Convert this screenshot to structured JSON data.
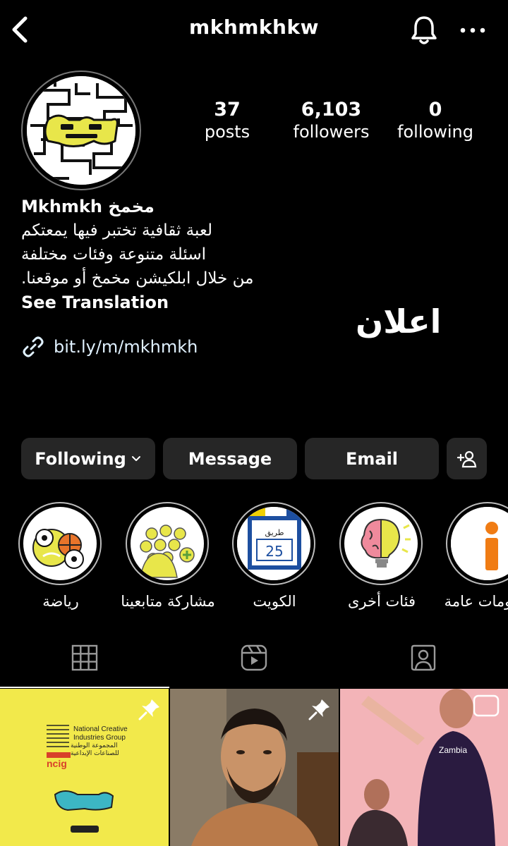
{
  "header": {
    "username": "mkhmkhkw",
    "icons": {
      "back": "back-chevron-icon",
      "bell": "bell-icon",
      "more": "more-dots-icon"
    }
  },
  "stats": {
    "posts": {
      "value": "37",
      "label": "posts"
    },
    "followers": {
      "value": "6,103",
      "label": "followers"
    },
    "following": {
      "value": "0",
      "label": "following"
    }
  },
  "bio": {
    "name": "Mkhmkh مخمخ",
    "lines": [
      "لعبة ثقافية تختبر فيها يمعتكم",
      "اسئلة متنوعة وفئات مختلفة",
      "من خلال ابلكيشن مخمخ أو موقعنا."
    ],
    "see_translation": "See Translation",
    "link": "bit.ly/m/mkhmkh"
  },
  "ad_label": "اعلان",
  "actions": {
    "following": "Following",
    "message": "Message",
    "email": "Email"
  },
  "highlights": [
    {
      "label": "رياضة",
      "icon": "sports-balls-icon"
    },
    {
      "label": "مشاركة متابعينا",
      "icon": "crowd-icon"
    },
    {
      "label": "الكويت",
      "icon": "street-sign-icon"
    },
    {
      "label": "فئات أخرى",
      "icon": "brain-bulb-icon"
    },
    {
      "label": "معلومات عامة",
      "icon": "info-icon"
    }
  ],
  "tabs": [
    {
      "name": "grid-tab",
      "icon": "grid-icon",
      "active": true
    },
    {
      "name": "reels-tab",
      "icon": "reels-icon",
      "active": false
    },
    {
      "name": "tagged-tab",
      "icon": "tagged-person-icon",
      "active": false
    }
  ],
  "posts": [
    {
      "pinned": true,
      "text_en": "National Creative Industries Group",
      "text_ar": "المجموعة الوطنية للصناعات الإبداعية",
      "brand": "ncig"
    },
    {
      "pinned": true
    },
    {
      "pinned": false,
      "shirt_text": "Zambia"
    }
  ],
  "colors": {
    "background": "#000000",
    "button": "#262626",
    "brand_yellow": "#e8e64a",
    "link": "#e0f1ff"
  }
}
